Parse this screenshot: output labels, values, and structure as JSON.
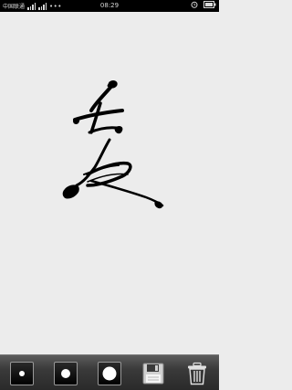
{
  "status_bar": {
    "carrier_text": "中国联通",
    "time": "08:29"
  },
  "toolbar": {
    "tools": [
      {
        "name": "brush-small",
        "icon": "small-dot-brush-icon"
      },
      {
        "name": "brush-medium",
        "icon": "medium-dot-brush-icon"
      },
      {
        "name": "brush-large",
        "icon": "large-dot-brush-icon"
      },
      {
        "name": "save",
        "icon": "floppy-disk-icon"
      },
      {
        "name": "clear",
        "icon": "trash-can-icon"
      }
    ]
  },
  "colors": {
    "canvas": "#ececec",
    "ink": "#000000",
    "toolbar": "#3a3a3a"
  }
}
